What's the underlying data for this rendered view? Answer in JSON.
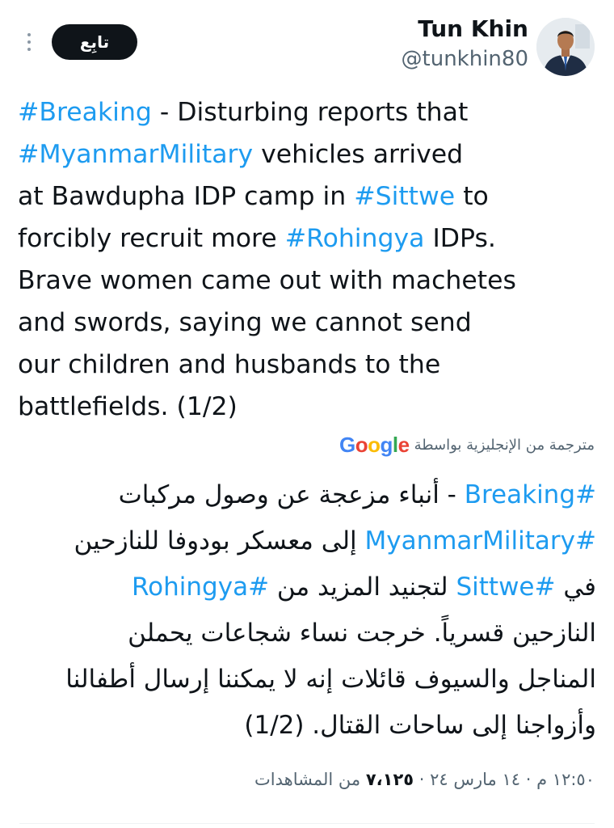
{
  "header": {
    "display_name": "Tun Khin",
    "handle": "@tunkhin80",
    "follow_label": "تابِع",
    "more_icon": "more-vertical-icon"
  },
  "tweet": {
    "lines": [
      [
        {
          "text": "#Breaking",
          "tag": true
        },
        {
          "text": " - Disturbing reports that",
          "tag": false
        }
      ],
      [
        {
          "text": "#MyanmarMilitary",
          "tag": true
        },
        {
          "text": " vehicles arrived",
          "tag": false
        }
      ],
      [
        {
          "text": "at Bawdupha IDP camp in ",
          "tag": false
        },
        {
          "text": "#Sittwe",
          "tag": true
        },
        {
          "text": " to",
          "tag": false
        }
      ],
      [
        {
          "text": "forcibly recruit more ",
          "tag": false
        },
        {
          "text": "#Rohingya",
          "tag": true
        },
        {
          "text": " IDPs.",
          "tag": false
        }
      ],
      [
        {
          "text": "Brave women came out with machetes",
          "tag": false
        }
      ],
      [
        {
          "text": "and swords, saying we cannot send",
          "tag": false
        }
      ],
      [
        {
          "text": "our children and husbands to the",
          "tag": false
        }
      ],
      [
        {
          "text": "battlefields. (1/2)",
          "tag": false
        }
      ]
    ]
  },
  "translation": {
    "label": "مترجمة من الإنجليزية بواسطة",
    "provider": "Google",
    "lines": [
      [
        {
          "text": "#Breaking",
          "tag": true
        },
        {
          "text": " - أنباء مزعجة عن وصول مركبات",
          "tag": false
        }
      ],
      [
        {
          "text": "#MyanmarMilitary",
          "tag": true
        },
        {
          "text": " إلى معسكر بودوفا للنازحين",
          "tag": false
        }
      ],
      [
        {
          "text": "في ",
          "tag": false
        },
        {
          "text": "#Sittwe",
          "tag": true
        },
        {
          "text": " لتجنيد المزيد من ",
          "tag": false
        },
        {
          "text": "#Rohingya",
          "tag": true
        }
      ],
      [
        {
          "text": "النازحين قسرياً. خرجت نساء شجاعات يحملن",
          "tag": false
        }
      ],
      [
        {
          "text": "المناجل والسيوف قائلات إنه لا يمكننا إرسال أطفالنا",
          "tag": false
        }
      ],
      [
        {
          "text": "وأزواجنا إلى ساحات القتال. (1/2)",
          "tag": false
        }
      ]
    ]
  },
  "meta": {
    "time": "١٢:٥٠ م",
    "date": "١٤ مارس ٢٤",
    "views_count": "٧،١٢٥",
    "views_label": "من المشاهدات",
    "separator": "·"
  },
  "colors": {
    "hashtag": "#1d9bf0",
    "text": "#0f1419",
    "secondary": "#536471",
    "follow_bg": "#0f1419"
  }
}
